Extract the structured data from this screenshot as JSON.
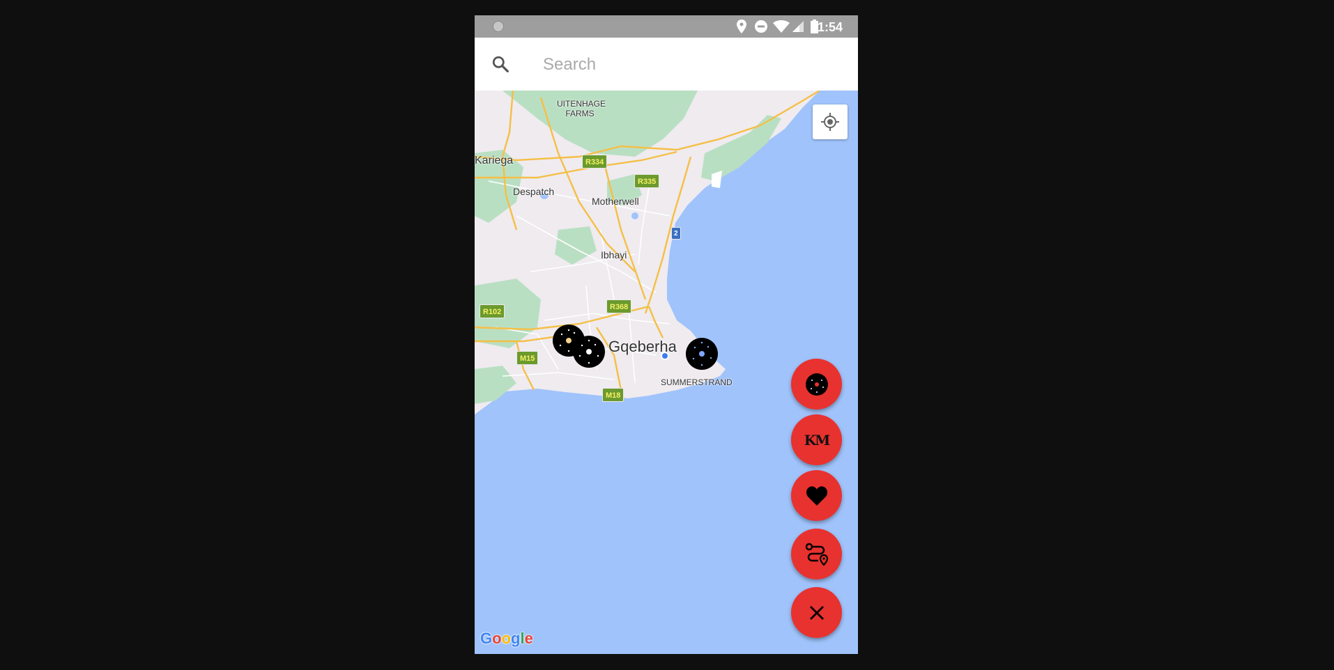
{
  "status_bar": {
    "time": "1:54",
    "icons": [
      "location-icon",
      "do-not-disturb-icon",
      "wifi-icon",
      "signal-icon",
      "battery-icon"
    ]
  },
  "search": {
    "placeholder": "Search",
    "value": ""
  },
  "map": {
    "provider_logo": "Google",
    "place_labels": {
      "uitenhage_farms_1": "UITENHAGE",
      "uitenhage_farms_2": "FARMS",
      "kariega": "Kariega",
      "despatch": "Despatch",
      "motherwell": "Motherwell",
      "ibhayi": "Ibhayi",
      "gqeberha": "Gqeberha",
      "summerstrand": "SUMMERSTRAND"
    },
    "route_shields": {
      "r334": "R334",
      "r335": "R335",
      "n2": "2",
      "r368": "R368",
      "r102": "R102",
      "m15": "M15",
      "m18": "M18"
    },
    "colors": {
      "water": "#a0c3fb",
      "land": "#efebef",
      "park": "#b9dfc3",
      "highway": "#f5bf46",
      "road": "#ffffff"
    },
    "markers": [
      "vinyl-record-marker",
      "vinyl-record-marker",
      "vinyl-record-marker"
    ]
  },
  "fab_actions": {
    "vinyl_icon": "vinyl-record-icon",
    "km_label": "KM",
    "heart_icon": "heart-icon",
    "route_icon": "route-icon",
    "close_icon": "close-icon",
    "color": "#e8322f"
  }
}
